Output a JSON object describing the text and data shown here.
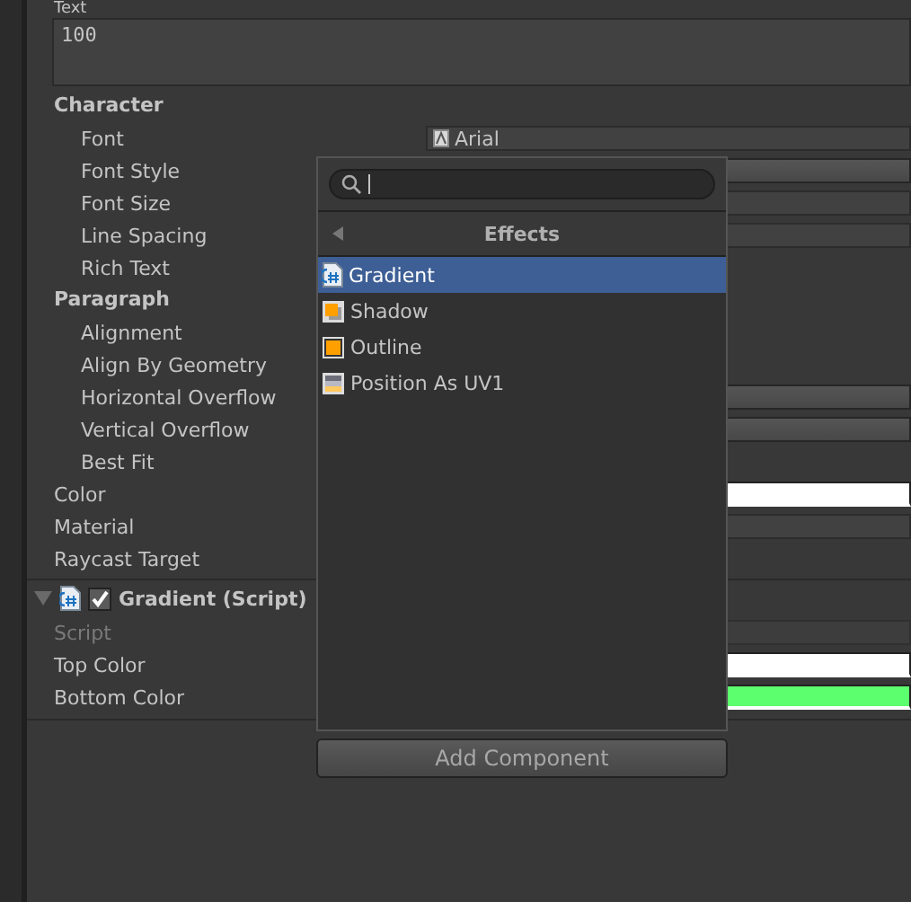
{
  "text_field": {
    "label": "Text",
    "value": "100"
  },
  "sections": [
    {
      "title": "Character",
      "rows": [
        {
          "label": "Font",
          "value": {
            "kind": "object",
            "text": "Arial"
          }
        },
        {
          "label": "Font Style",
          "value": {
            "kind": "dropdown"
          }
        },
        {
          "label": "Font Size",
          "value": {
            "kind": "number"
          }
        },
        {
          "label": "Line Spacing",
          "value": {
            "kind": "number"
          }
        },
        {
          "label": "Rich Text"
        }
      ]
    },
    {
      "title": "Paragraph",
      "rows": [
        {
          "label": "Alignment"
        },
        {
          "label": "Align By Geometry"
        },
        {
          "label": "Horizontal Overflow",
          "value": {
            "kind": "dropdown"
          }
        },
        {
          "label": "Vertical Overflow",
          "value": {
            "kind": "dropdown"
          }
        },
        {
          "label": "Best Fit"
        }
      ]
    }
  ],
  "properties": [
    {
      "label": "Color",
      "value": {
        "kind": "color",
        "color": "#ffffff"
      }
    },
    {
      "label": "Material",
      "value": {
        "kind": "object"
      }
    },
    {
      "label": "Raycast Target"
    }
  ],
  "component": {
    "title": "Gradient (Script)",
    "expanded": true,
    "enabled": true,
    "rows": [
      {
        "label": "Script",
        "disabled": true,
        "value": {
          "kind": "object"
        }
      },
      {
        "label": "Top Color",
        "disabled": false,
        "value": {
          "kind": "color",
          "color": "#ffffff"
        }
      },
      {
        "label": "Bottom Color",
        "disabled": false,
        "value": {
          "kind": "color",
          "color": "#5cff6e"
        }
      }
    ]
  },
  "add_component_button": "Add Component",
  "popup": {
    "category": "Effects",
    "items": [
      {
        "label": "Gradient",
        "kind": "script",
        "selected": true
      },
      {
        "label": "Shadow",
        "kind": "shadow",
        "selected": false
      },
      {
        "label": "Outline",
        "kind": "outline",
        "selected": false
      },
      {
        "label": "Position As UV1",
        "kind": "uv",
        "selected": false
      }
    ]
  }
}
